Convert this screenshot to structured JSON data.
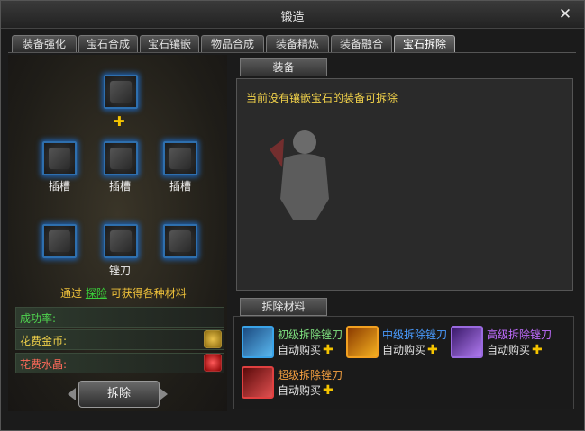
{
  "window": {
    "title": "锻造",
    "close_symbol": "✕"
  },
  "tabs": [
    {
      "label": "装备强化",
      "active": false
    },
    {
      "label": "宝石合成",
      "active": false
    },
    {
      "label": "宝石镶嵌",
      "active": false
    },
    {
      "label": "物品合成",
      "active": false
    },
    {
      "label": "装备精炼",
      "active": false
    },
    {
      "label": "装备融合",
      "active": false
    },
    {
      "label": "宝石拆除",
      "active": true
    }
  ],
  "left": {
    "slot_label": "插槽",
    "knife_label": "锉刀",
    "hint_prefix": "通过",
    "hint_link": "探险",
    "hint_suffix": "可获得各种材料",
    "success_rate_label": "成功率:",
    "gold_cost_label": "花费金币:",
    "crystal_cost_label": "花费水晶:",
    "dismantle_button": "拆除"
  },
  "equipment": {
    "header": "装备",
    "message": "当前没有镶嵌宝石的装备可拆除"
  },
  "materials": {
    "header": "拆除材料",
    "items": [
      {
        "name": "初级拆除锉刀",
        "auto_buy": "自动购买",
        "name_color": "#7fe07f",
        "frame_color": "#3aa3e8",
        "icon": "blue-file-icon"
      },
      {
        "name": "中级拆除锉刀",
        "auto_buy": "自动购买",
        "name_color": "#4a9cff",
        "frame_color": "#f2a020",
        "icon": "orange-file-icon"
      },
      {
        "name": "高级拆除锉刀",
        "auto_buy": "自动购买",
        "name_color": "#c06cff",
        "frame_color": "#9a6ae0",
        "icon": "purple-file-icon"
      },
      {
        "name": "超级拆除锉刀",
        "auto_buy": "自动购买",
        "name_color": "#f5a040",
        "frame_color": "#e04040",
        "icon": "red-file-icon"
      }
    ]
  }
}
